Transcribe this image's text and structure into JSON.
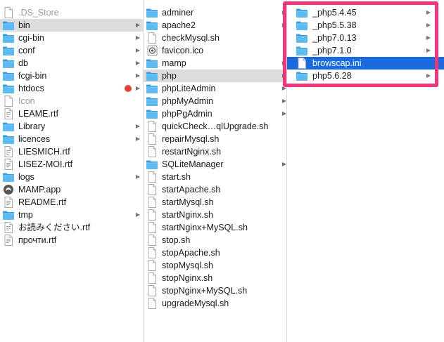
{
  "colors": {
    "selection_blue": "#1a6ae0",
    "selection_gray": "#dcdcdc",
    "annotation_pink": "#f0357a",
    "tag_red": "#e8423a",
    "folder_blue": "#4fb3ee"
  },
  "column1": {
    "items": [
      {
        "label": ".DS_Store",
        "icon": "file-icon",
        "dim": true
      },
      {
        "label": "bin",
        "icon": "folder-icon",
        "chevron": true,
        "selected": "gray"
      },
      {
        "label": "cgi-bin",
        "icon": "folder-icon",
        "chevron": true
      },
      {
        "label": "conf",
        "icon": "folder-icon",
        "chevron": true
      },
      {
        "label": "db",
        "icon": "folder-icon",
        "chevron": true
      },
      {
        "label": "fcgi-bin",
        "icon": "folder-icon",
        "chevron": true
      },
      {
        "label": "htdocs",
        "icon": "folder-icon",
        "chevron": true,
        "tag": "red"
      },
      {
        "label": "Icon",
        "icon": "file-icon",
        "dim": true
      },
      {
        "label": "LEAME.rtf",
        "icon": "rtf-icon"
      },
      {
        "label": "Library",
        "icon": "folder-icon",
        "chevron": true
      },
      {
        "label": "licences",
        "icon": "folder-icon",
        "chevron": true
      },
      {
        "label": "LIESMICH.rtf",
        "icon": "rtf-icon"
      },
      {
        "label": "LISEZ-MOI.rtf",
        "icon": "rtf-icon"
      },
      {
        "label": "logs",
        "icon": "folder-icon",
        "chevron": true
      },
      {
        "label": "MAMP.app",
        "icon": "app-icon"
      },
      {
        "label": "README.rtf",
        "icon": "rtf-icon"
      },
      {
        "label": "tmp",
        "icon": "folder-icon",
        "chevron": true
      },
      {
        "label": "お読みください.rtf",
        "icon": "rtf-icon"
      },
      {
        "label": "прочти.rtf",
        "icon": "rtf-icon"
      }
    ]
  },
  "column2": {
    "items": [
      {
        "label": "adminer",
        "icon": "folder-icon",
        "chevron": true
      },
      {
        "label": "apache2",
        "icon": "folder-icon",
        "chevron": true
      },
      {
        "label": "checkMysql.sh",
        "icon": "file-icon"
      },
      {
        "label": "favicon.ico",
        "icon": "image-icon"
      },
      {
        "label": "mamp",
        "icon": "folder-icon",
        "chevron": true
      },
      {
        "label": "php",
        "icon": "folder-icon",
        "chevron": true,
        "selected": "gray"
      },
      {
        "label": "phpLiteAdmin",
        "icon": "folder-icon",
        "chevron": true
      },
      {
        "label": "phpMyAdmin",
        "icon": "folder-icon",
        "chevron": true
      },
      {
        "label": "phpPgAdmin",
        "icon": "folder-icon",
        "chevron": true
      },
      {
        "label": "quickCheck…qlUpgrade.sh",
        "icon": "file-icon"
      },
      {
        "label": "repairMysql.sh",
        "icon": "file-icon"
      },
      {
        "label": "restartNginx.sh",
        "icon": "file-icon"
      },
      {
        "label": "SQLiteManager",
        "icon": "folder-icon",
        "chevron": true
      },
      {
        "label": "start.sh",
        "icon": "file-icon"
      },
      {
        "label": "startApache.sh",
        "icon": "file-icon"
      },
      {
        "label": "startMysql.sh",
        "icon": "file-icon"
      },
      {
        "label": "startNginx.sh",
        "icon": "file-icon"
      },
      {
        "label": "startNginx+MySQL.sh",
        "icon": "file-icon"
      },
      {
        "label": "stop.sh",
        "icon": "file-icon"
      },
      {
        "label": "stopApache.sh",
        "icon": "file-icon"
      },
      {
        "label": "stopMysql.sh",
        "icon": "file-icon"
      },
      {
        "label": "stopNginx.sh",
        "icon": "file-icon"
      },
      {
        "label": "stopNginx+MySQL.sh",
        "icon": "file-icon"
      },
      {
        "label": "upgradeMysql.sh",
        "icon": "file-icon"
      }
    ]
  },
  "column3": {
    "items": [
      {
        "label": "_php5.4.45",
        "icon": "folder-icon",
        "chevron": true
      },
      {
        "label": "_php5.5.38",
        "icon": "folder-icon",
        "chevron": true
      },
      {
        "label": "_php7.0.13",
        "icon": "folder-icon",
        "chevron": true
      },
      {
        "label": "_php7.1.0",
        "icon": "folder-icon",
        "chevron": true
      },
      {
        "label": "browscap.ini",
        "icon": "file-icon",
        "selected": "blue"
      },
      {
        "label": "php5.6.28",
        "icon": "folder-icon",
        "chevron": true
      }
    ]
  }
}
